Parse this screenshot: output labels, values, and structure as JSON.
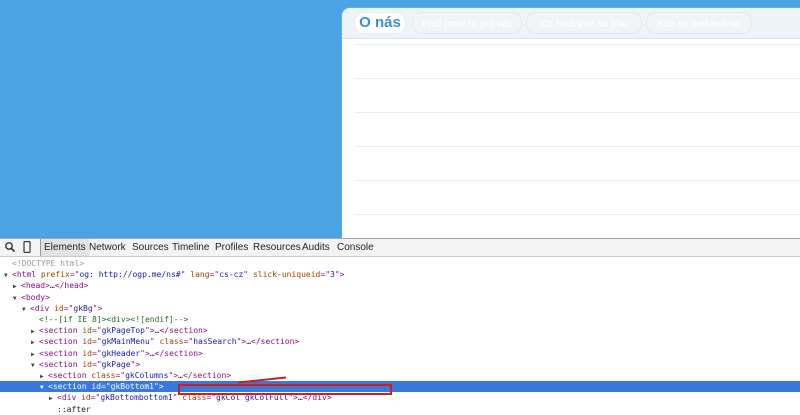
{
  "page": {
    "tabs": [
      {
        "label": "O nás",
        "active": true
      },
      {
        "label": "Proč jsme tu pro vás",
        "active": false
      },
      {
        "label": "Co hledáme na trhu",
        "active": false
      },
      {
        "label": "Kde se setkáváme",
        "active": false
      }
    ]
  },
  "devtools": {
    "tabs": [
      "Elements",
      "Network",
      "Sources",
      "Timeline",
      "Profiles",
      "Resources",
      "Audits",
      "Console"
    ],
    "active_tab": "Elements",
    "icons": [
      "search-icon",
      "device-mode-icon"
    ],
    "dom": [
      {
        "indent": 0,
        "toggle": "",
        "text": "<!DOCTYPE html>"
      },
      {
        "indent": 0,
        "toggle": "▼",
        "text": "<html prefix=\"og: http://ogp.me/ns#\" lang=\"cs-cz\" slick-uniqueid=\"3\">"
      },
      {
        "indent": 1,
        "toggle": "▶",
        "text": "<head>…</head>"
      },
      {
        "indent": 1,
        "toggle": "▼",
        "text": "<body>"
      },
      {
        "indent": 2,
        "toggle": "▼",
        "text": "<div id=\"gkBg\">"
      },
      {
        "indent": 3,
        "toggle": "",
        "text": "<!--[if IE 8]><div><![endif]-->"
      },
      {
        "indent": 3,
        "toggle": "▶",
        "text": "<section id=\"gkPageTop\">…</section>"
      },
      {
        "indent": 3,
        "toggle": "▶",
        "text": "<section id=\"gkMainMenu\" class=\"hasSearch\">…</section>"
      },
      {
        "indent": 3,
        "toggle": "▶",
        "text": "<section id=\"gkHeader\">…</section>"
      },
      {
        "indent": 3,
        "toggle": "▼",
        "text": "<section id=\"gkPage\">"
      },
      {
        "indent": 4,
        "toggle": "▶",
        "text": "<section class=\"gkColumns\">…</section>"
      },
      {
        "indent": 4,
        "toggle": "▼",
        "text": "<section id=\"gkBottom1\">",
        "selected": true
      },
      {
        "indent": 5,
        "toggle": "▶",
        "text": "<div id=\"gkBottombottom1\" class=\"gkCol gkColFull\">…</div>"
      },
      {
        "indent": 5,
        "toggle": "",
        "text": "::after"
      }
    ]
  }
}
